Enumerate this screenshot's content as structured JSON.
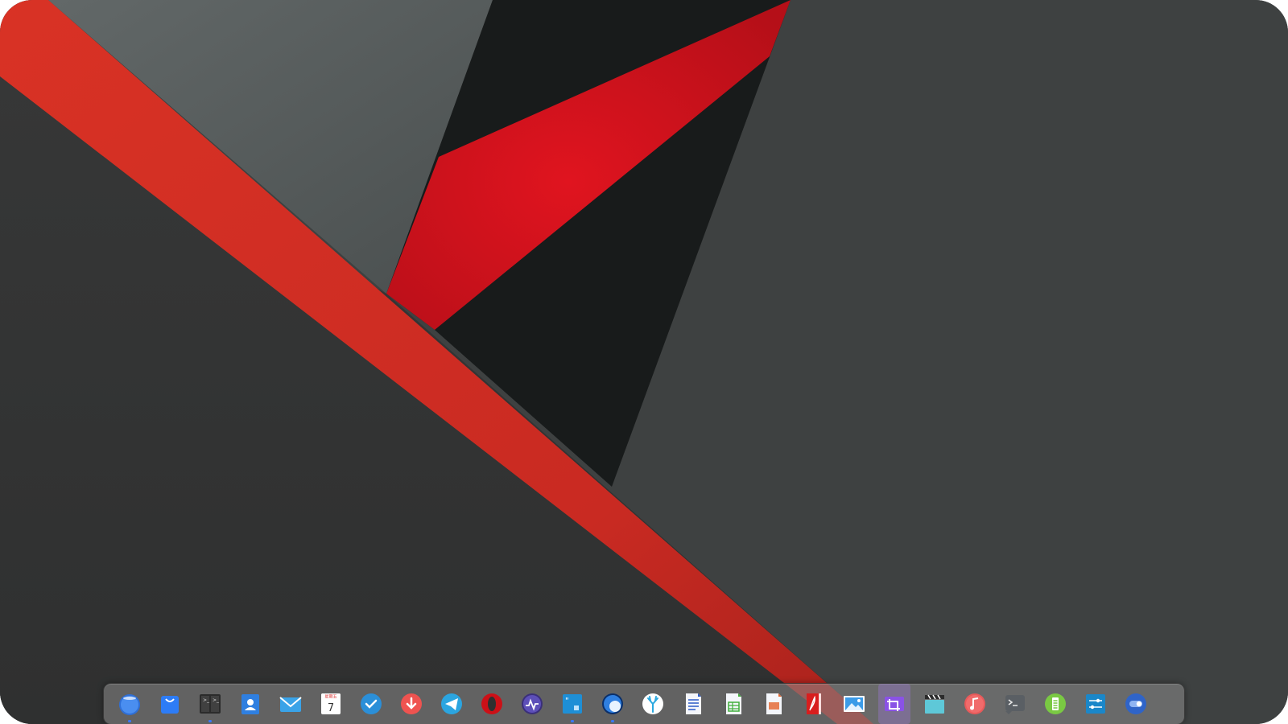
{
  "desktop": {
    "wallpaper": {
      "colors": {
        "base": "#3e4141",
        "dark_region": "#323233",
        "light_region": "#5a5f5f",
        "black_band": "#181b1b",
        "red_band": "#d22c22",
        "red_wedge": "#dc1520"
      }
    }
  },
  "dock": {
    "items": [
      {
        "name": "launcher-icon",
        "running": true
      },
      {
        "name": "app-store-icon",
        "running": false
      },
      {
        "name": "multitasking-view-icon",
        "running": true
      },
      {
        "name": "contacts-icon",
        "running": false
      },
      {
        "name": "mail-icon",
        "running": false
      },
      {
        "name": "calendar-icon",
        "running": false,
        "weekday": "星期五",
        "day": "7"
      },
      {
        "name": "task-check-icon",
        "running": false
      },
      {
        "name": "downloader-icon",
        "running": false
      },
      {
        "name": "telegram-icon",
        "running": false
      },
      {
        "name": "opera-browser-icon",
        "running": false
      },
      {
        "name": "system-monitor-icon",
        "running": false
      },
      {
        "name": "text-editor-icon",
        "running": true
      },
      {
        "name": "web-browser-icon",
        "running": true
      },
      {
        "name": "coral-app-icon",
        "running": false
      },
      {
        "name": "writer-document-icon",
        "running": false
      },
      {
        "name": "calc-spreadsheet-icon",
        "running": false
      },
      {
        "name": "impress-presentation-icon",
        "running": false
      },
      {
        "name": "pdf-reader-icon",
        "running": false
      },
      {
        "name": "image-viewer-icon",
        "running": false
      },
      {
        "name": "screenshot-crop-icon",
        "running": false,
        "hovered": true
      },
      {
        "name": "video-player-icon",
        "running": false
      },
      {
        "name": "music-player-icon",
        "running": false
      },
      {
        "name": "terminal-icon",
        "running": false
      },
      {
        "name": "battery-power-icon",
        "running": false
      },
      {
        "name": "settings-sliders-icon",
        "running": false
      },
      {
        "name": "toggle-control-icon",
        "running": false
      }
    ]
  }
}
